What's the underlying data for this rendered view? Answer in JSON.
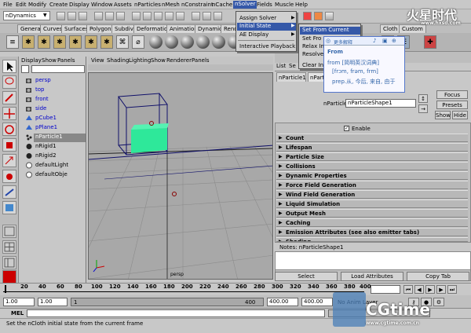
{
  "menubar": [
    "File",
    "Edit",
    "Modify",
    "Create",
    "Display",
    "Window",
    "Assets",
    "nParticles",
    "nMesh",
    "nConstraint",
    "nCache",
    "nSolver",
    "Fields",
    "Muscle",
    "Help"
  ],
  "mode_select": "nDynamics",
  "shelf_tabs": [
    "General",
    "Curves",
    "Surfaces",
    "Polygons",
    "Subdivs",
    "Deformation",
    "Animation",
    "Dynamics",
    "Rend"
  ],
  "shelf_tabs_right": [
    "Cloth",
    "Custom"
  ],
  "outliner": {
    "menu": [
      "Display",
      "Show",
      "Panels"
    ],
    "items": [
      "persp",
      "top",
      "front",
      "side",
      "pCube1",
      "pPlane1",
      "nParticle1",
      "nRigid1",
      "nRigid2",
      "defaultLight",
      "defaultObje"
    ],
    "selected": "nParticle1"
  },
  "viewport": {
    "menu": [
      "View",
      "Shading",
      "Lighting",
      "Show",
      "Renderer",
      "Panels"
    ],
    "camera_label": "persp"
  },
  "nsolver_menu": {
    "items": [
      "Assign Solver",
      "Initial State",
      "AE Display",
      "Interactive Playback"
    ],
    "highlighted": "Initial State"
  },
  "initial_state_menu": {
    "items": [
      "Set From Current",
      "Set Fro",
      "Relax Ini",
      "Resolve In",
      "Clear Initi"
    ],
    "highlighted": "Set From Current"
  },
  "dictionary_popup": {
    "header": "更多解释",
    "word": "From",
    "source": "from [简明英汉词典]",
    "phonetic": "[frɔm, frəm, frm]",
    "meaning": "prep.从, 今后, 来自, 由于"
  },
  "attr_editor": {
    "tabs_top": [
      "List",
      "Se"
    ],
    "tabs": [
      "nParticle1",
      "nParticle"
    ],
    "name_label": "nParticle:",
    "name_value": "nParticleShape1",
    "buttons": [
      "Focus",
      "Presets",
      "Show",
      "Hide"
    ],
    "enable_label": "Enable",
    "sections": [
      "Count",
      "Lifespan",
      "Particle Size",
      "Collisions",
      "Dynamic Properties",
      "Force Field Generation",
      "Wind Field Generation",
      "Liquid Simulation",
      "Output Mesh",
      "Caching",
      "Emission Attributes (see also emitter tabs)",
      "Shading"
    ],
    "notes_label": "Notes:  nParticleShape1",
    "bottom_buttons": [
      "Select",
      "Load Attributes",
      "Copy Tab"
    ]
  },
  "timeline": {
    "ticks": [
      "20",
      "40",
      "60",
      "80",
      "100",
      "120",
      "140",
      "160",
      "180",
      "200",
      "220",
      "240",
      "260",
      "280",
      "300",
      "320",
      "340",
      "360",
      "380",
      "400"
    ],
    "range_start": "1.00",
    "range_inner_start": "1.00",
    "range_current": "1",
    "range_inner_end": "400",
    "range_end": "400.00",
    "range_end2": "400.00",
    "anim_layer": "No Anim Layer"
  },
  "mel_label": "MEL",
  "help_text": "Set the nCloth initial state from the current frame",
  "watermarks": {
    "top_right": "火星时代",
    "top_right_url": "www.hxsd.com",
    "bottom_right": "CGtime",
    "bottom_right_url": "www.cgtime.com.cn"
  }
}
